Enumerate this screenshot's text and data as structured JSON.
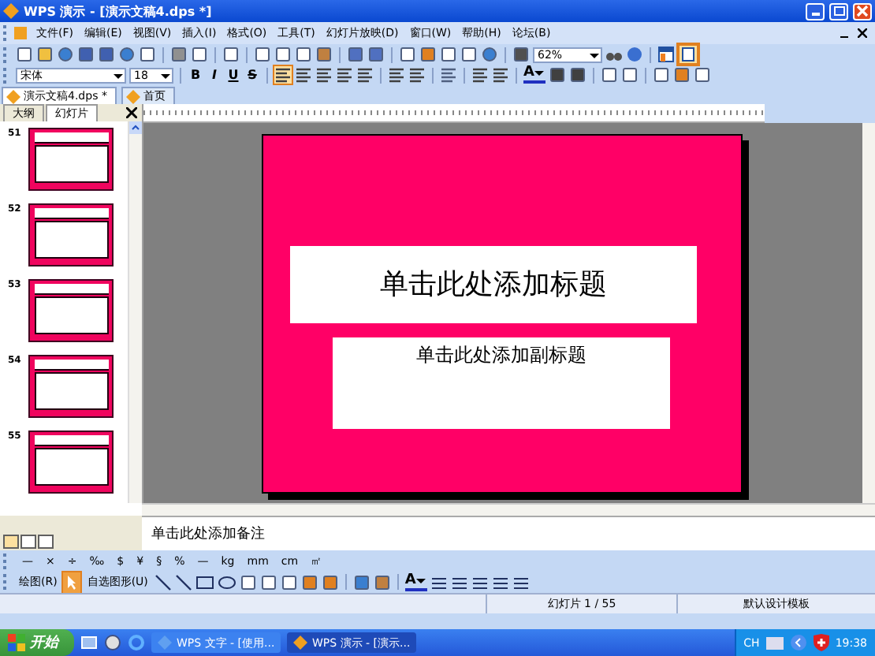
{
  "window": {
    "title": "WPS 演示 - [演示文稿4.dps *]"
  },
  "menu": [
    "文件(F)",
    "编辑(E)",
    "视图(V)",
    "插入(I)",
    "格式(O)",
    "工具(T)",
    "幻灯片放映(D)",
    "窗口(W)",
    "帮助(H)",
    "论坛(B)"
  ],
  "toolbar": {
    "zoom": "62%"
  },
  "format_bar": {
    "font": "宋体",
    "size": "18",
    "styles": [
      "B",
      "I",
      "U",
      "S"
    ],
    "font_color_label": "A"
  },
  "doc_tabs": [
    {
      "label": "演示文稿4.dps *",
      "selected": true
    },
    {
      "label": "首页",
      "selected": false
    }
  ],
  "panel_tabs": [
    {
      "label": "大纲",
      "selected": false
    },
    {
      "label": "幻灯片",
      "selected": true
    }
  ],
  "thumbnails": [
    {
      "number": "51",
      "selected": false
    },
    {
      "number": "52",
      "selected": false
    },
    {
      "number": "53",
      "selected": false
    },
    {
      "number": "54",
      "selected": false
    },
    {
      "number": "55",
      "selected": false
    }
  ],
  "slide": {
    "title": "单击此处添加标题",
    "subtitle": "单击此处添加副标题"
  },
  "notes": {
    "placeholder": "单击此处添加备注"
  },
  "symbols": [
    "—",
    "×",
    "÷",
    "‰",
    "$",
    "¥",
    "§",
    "%",
    "—",
    "kg",
    "mm",
    "cm",
    "㎡"
  ],
  "drawing_bar": {
    "draw": "绘图(R)",
    "shapes": "自选图形(U)",
    "font_color_label": "A"
  },
  "status_bar": {
    "slide": "幻灯片 1 / 55",
    "template": "默认设计模板"
  },
  "taskbar": {
    "start": "开始",
    "tasks": [
      {
        "label": "WPS 文字 - [使用...",
        "selected": false
      },
      {
        "label": "WPS 演示 - [演示...",
        "selected": true
      }
    ],
    "language": "CH",
    "clock": "19:38"
  }
}
